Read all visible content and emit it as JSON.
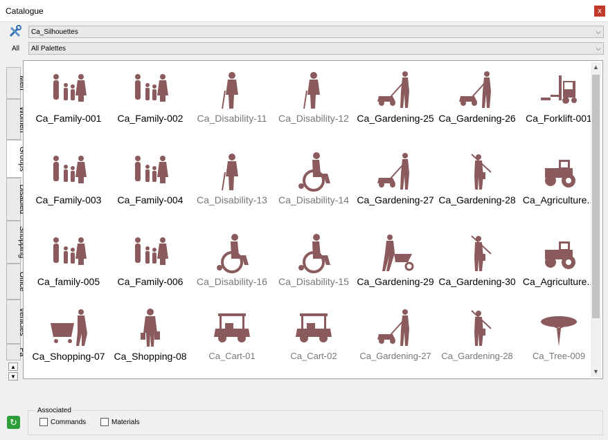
{
  "window": {
    "title": "Catalogue",
    "close_label": "x"
  },
  "filters": {
    "tool_icon": "tools-icon",
    "category_value": "Ca_Silhouettes",
    "all_label": "All",
    "palette_value": "All Palettes"
  },
  "tabs": [
    "Men",
    "Women",
    "Groups",
    "Disabled",
    "Shopping",
    "Office",
    "Vehicles",
    "Fa"
  ],
  "active_tab": "Groups",
  "accent_color": "#8b5a5c",
  "items": [
    {
      "label": "Ca_Family-001",
      "icon": "family-icon",
      "dim": false
    },
    {
      "label": "Ca_Family-002",
      "icon": "family-icon",
      "dim": false
    },
    {
      "label": "Ca_Disability-11",
      "icon": "person-cane-icon",
      "dim": true
    },
    {
      "label": "Ca_Disability-12",
      "icon": "person-cane-icon",
      "dim": true
    },
    {
      "label": "Ca_Gardening-25",
      "icon": "lawn-mower-icon",
      "dim": false
    },
    {
      "label": "Ca_Gardening-26",
      "icon": "lawn-mower-icon",
      "dim": false
    },
    {
      "label": "Ca_Forklift-001",
      "icon": "forklift-icon",
      "dim": false
    },
    {
      "label": "Ca_Family-003",
      "icon": "family-icon",
      "dim": false
    },
    {
      "label": "Ca_Family-004",
      "icon": "family-icon",
      "dim": false
    },
    {
      "label": "Ca_Disability-13",
      "icon": "person-cane-icon",
      "dim": true
    },
    {
      "label": "Ca_Disability-14",
      "icon": "wheelchair-icon",
      "dim": true
    },
    {
      "label": "Ca_Gardening-27",
      "icon": "lawn-mower-icon",
      "dim": false
    },
    {
      "label": "Ca_Gardening-28",
      "icon": "gardener-icon",
      "dim": false
    },
    {
      "label": "Ca_Agriculture...",
      "icon": "tractor-icon",
      "dim": false
    },
    {
      "label": "Ca_family-005",
      "icon": "family-icon",
      "dim": false
    },
    {
      "label": "Ca_Family-006",
      "icon": "family-icon",
      "dim": false
    },
    {
      "label": "Ca_Disability-16",
      "icon": "wheelchair-icon",
      "dim": true
    },
    {
      "label": "Ca_Disability-15",
      "icon": "wheelchair-icon",
      "dim": true
    },
    {
      "label": "Ca_Gardening-29",
      "icon": "wheelbarrow-icon",
      "dim": false
    },
    {
      "label": "Ca_Gardening-30",
      "icon": "gardener-icon",
      "dim": false
    },
    {
      "label": "Ca_Agriculture...",
      "icon": "tractor-icon",
      "dim": false
    },
    {
      "label": "Ca_Shopping-07",
      "icon": "shopping-cart-icon",
      "dim": false
    },
    {
      "label": "Ca_Shopping-08",
      "icon": "shopper-icon",
      "dim": false
    },
    {
      "label": "Ca_Cart-01",
      "icon": "golf-cart-icon",
      "dim": true
    },
    {
      "label": "Ca_Cart-02",
      "icon": "golf-cart-icon",
      "dim": true
    },
    {
      "label": "Ca_Gardening-27",
      "icon": "lawn-mower-icon",
      "dim": true
    },
    {
      "label": "Ca_Gardening-28",
      "icon": "gardener-icon",
      "dim": true
    },
    {
      "label": "Ca_Tree-009",
      "icon": "tree-icon",
      "dim": true
    }
  ],
  "footer": {
    "associated_label": "Associated",
    "commands_label": "Commands",
    "materials_label": "Materials",
    "refresh_icon": "refresh-icon"
  }
}
